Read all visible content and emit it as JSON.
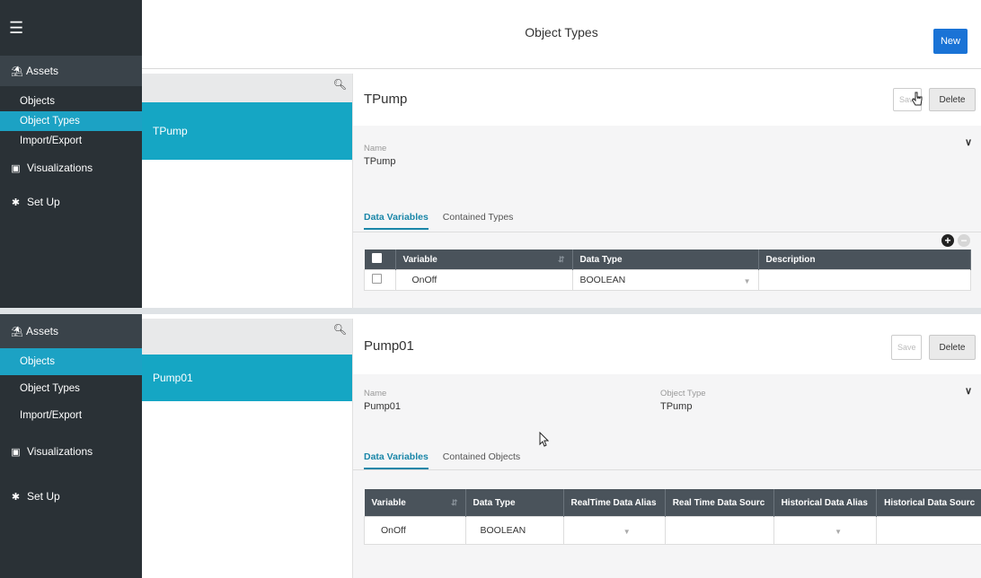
{
  "panel1": {
    "sidebar": {
      "assets_label": "Assets",
      "items": [
        {
          "label": "Objects",
          "active": false
        },
        {
          "label": "Object Types",
          "active": true
        },
        {
          "label": "Import/Export",
          "active": false
        }
      ],
      "visualizations_label": "Visualizations",
      "setup_label": "Set Up"
    },
    "header": {
      "title": "Object Types",
      "new_label": "New"
    },
    "list": {
      "selected": "TPump"
    },
    "detail": {
      "title": "TPump",
      "save_label": "Save",
      "delete_label": "Delete",
      "name_label": "Name",
      "name_value": "TPump",
      "tabs": [
        "Data Variables",
        "Contained Types"
      ],
      "table": {
        "columns": [
          "Variable",
          "Data Type",
          "Description"
        ],
        "rows": [
          {
            "variable": "OnOff",
            "data_type": "BOOLEAN",
            "description": ""
          }
        ]
      }
    }
  },
  "panel2": {
    "sidebar": {
      "assets_label": "Assets",
      "items": [
        {
          "label": "Objects",
          "active": true
        },
        {
          "label": "Object Types",
          "active": false
        },
        {
          "label": "Import/Export",
          "active": false
        }
      ],
      "visualizations_label": "Visualizations",
      "setup_label": "Set Up"
    },
    "list": {
      "selected": "Pump01"
    },
    "detail": {
      "title": "Pump01",
      "save_label": "Save",
      "delete_label": "Delete",
      "name_label": "Name",
      "name_value": "Pump01",
      "object_type_label": "Object Type",
      "object_type_value": "TPump",
      "tabs": [
        "Data Variables",
        "Contained Objects"
      ],
      "table": {
        "columns": [
          "Variable",
          "Data Type",
          "RealTime Data Alias",
          "Real Time Data Sourc",
          "Historical Data Alias",
          "Historical Data Sourc"
        ],
        "rows": [
          {
            "variable": "OnOff",
            "data_type": "BOOLEAN"
          }
        ]
      }
    }
  },
  "colors": {
    "sidebar": "#2a3136",
    "accent": "#15a6c4",
    "primary_button": "#1a73d6",
    "table_header": "#4a535b"
  }
}
